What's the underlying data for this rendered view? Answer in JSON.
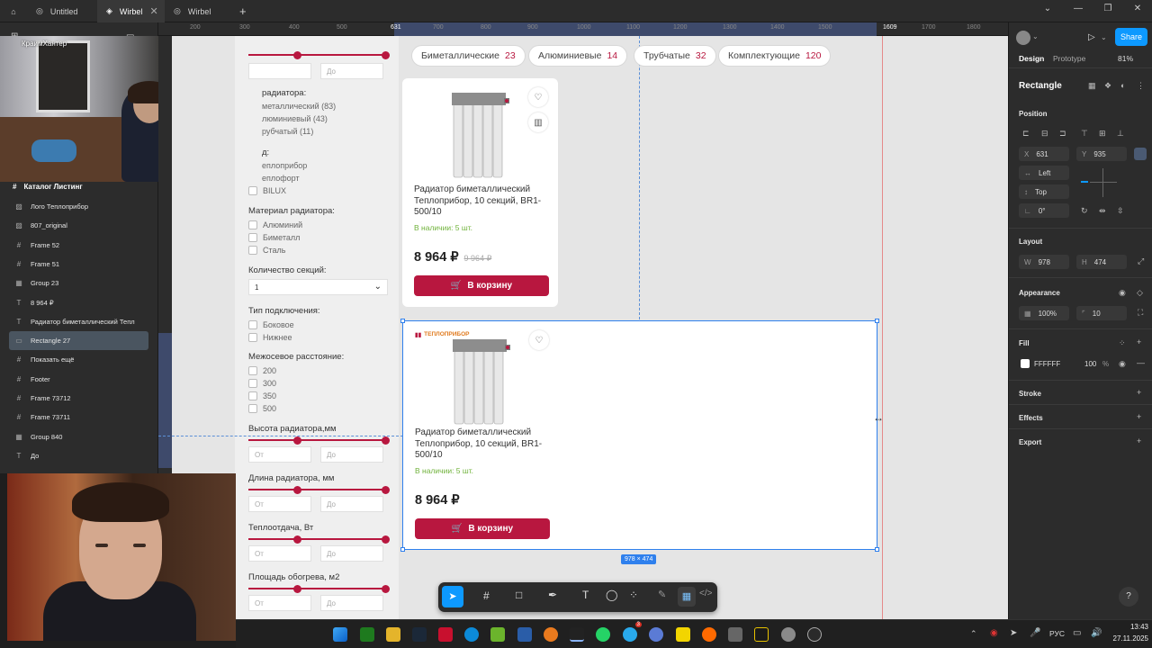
{
  "window": {
    "tabs": [
      {
        "label": "Untitled"
      },
      {
        "label": "Wirbel"
      },
      {
        "label": "Wirbel"
      }
    ],
    "new_tab": "+"
  },
  "webcam_label": "КраимХантер",
  "left_panel": {
    "frame_label": "Каталог Листинг",
    "layers": [
      {
        "label": "Лого Теплоприбор",
        "icon": "image-icon"
      },
      {
        "label": "807_original",
        "icon": "image-icon"
      },
      {
        "label": "Frame 52",
        "icon": "frame-icon"
      },
      {
        "label": "Frame 51",
        "icon": "frame-icon"
      },
      {
        "label": "Group 23",
        "icon": "group-icon"
      },
      {
        "label": "8 964 ₽",
        "icon": "text-icon"
      },
      {
        "label": "Радиатор биметаллический Тепл",
        "icon": "text-icon"
      },
      {
        "label": "Rectangle 27",
        "icon": "rectangle-icon"
      },
      {
        "label": "Показать ещё",
        "icon": "frame-icon"
      },
      {
        "label": "Footer",
        "icon": "frame-icon"
      },
      {
        "label": "Frame 73712",
        "icon": "frame-icon"
      },
      {
        "label": "Frame 73711",
        "icon": "frame-icon"
      },
      {
        "label": "Group 840",
        "icon": "group-icon"
      },
      {
        "label": "До",
        "icon": "text-icon"
      }
    ]
  },
  "ruler": {
    "ticks": [
      "200",
      "300",
      "400",
      "500",
      "631",
      "700",
      "800",
      "900",
      "1000",
      "1100",
      "1200",
      "1300",
      "1400",
      "1500",
      "1609",
      "1700",
      "1800"
    ]
  },
  "filters": {
    "range_placeholder_to": "До",
    "range_placeholder_from": "От",
    "section_type": "радиатора:",
    "type_options": [
      "металлический (83)",
      "люминиевый (43)",
      "рубчатый (11)"
    ],
    "section_brand": "д:",
    "brand_options": [
      "еплоприбор",
      "еплофорт",
      "BILUX"
    ],
    "material_title": "Материал радиатора:",
    "material_options": [
      "Алюминий",
      "Биметалл",
      "Сталь"
    ],
    "sections_title": "Количество секций:",
    "sections_value": "1",
    "connection_title": "Тип подключения:",
    "connection_options": [
      "Боковое",
      "Нижнее"
    ],
    "distance_title": "Межосевое расстояние:",
    "distance_options": [
      "200",
      "300",
      "350",
      "500"
    ],
    "height_title": "Высота радиатора,мм",
    "length_title": "Длина радиатора, мм",
    "heat_title": "Теплоотдача, Вт",
    "area_title": "Площадь обогрева, м2"
  },
  "chips": [
    {
      "label": "Биметаллические",
      "count": "23"
    },
    {
      "label": "Алюминиевые",
      "count": "14"
    },
    {
      "label": "Трубчатые",
      "count": "32"
    },
    {
      "label": "Комплектующие",
      "count": "120"
    }
  ],
  "cards": [
    {
      "title": "Радиатор биметаллический Теплоприбор, 10 секций, BR1-500/10",
      "stock": "В наличии: 5 шт.",
      "price": "8 964 ₽",
      "old_price": "9 964 ₽",
      "button": "В корзину"
    },
    {
      "brand": "ТЕПЛОПРИБОР",
      "title": "Радиатор биметаллический Теплоприбор, 10 секций, BR1-500/10",
      "stock": "В наличии: 5 шт.",
      "price": "8 964 ₽",
      "button": "В корзину"
    }
  ],
  "selection_size": "978 × 474",
  "right_panel": {
    "tabs": {
      "design": "Design",
      "prototype": "Prototype"
    },
    "zoom": "81%",
    "share": "Share",
    "element_title": "Rectangle",
    "position_title": "Position",
    "x_label": "X",
    "x": "631",
    "y_label": "Y",
    "y": "935",
    "constraint_h": "Left",
    "constraint_v": "Top",
    "rotation": "0°",
    "layout_title": "Layout",
    "w_label": "W",
    "w": "978",
    "h_label": "H",
    "h": "474",
    "appearance_title": "Appearance",
    "opacity": "100%",
    "radius": "10",
    "fill_title": "Fill",
    "fill_hex": "FFFFFF",
    "fill_opacity": "100",
    "fill_pct": "%",
    "stroke_title": "Stroke",
    "effects_title": "Effects",
    "export_title": "Export",
    "help": "?"
  },
  "taskbar": {
    "lang": "РУС",
    "time": "13:43",
    "date": "27.11.2025",
    "notification_count": "3"
  },
  "colors": {
    "accent": "#b8173f",
    "stock_green": "#6fb23a",
    "figma_blue": "#0d99ff",
    "selection": "#2f80ed"
  }
}
